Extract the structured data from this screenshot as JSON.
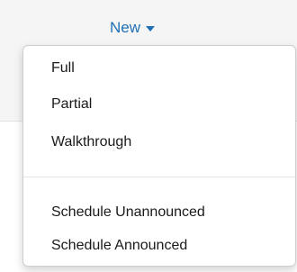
{
  "header": {
    "new_label": "New",
    "caret_icon": "caret-down-icon",
    "accent_color": "#1f6fb5"
  },
  "menu": {
    "items": [
      {
        "label": "Full"
      },
      {
        "label": "Partial"
      },
      {
        "label": "Walkthrough"
      }
    ],
    "schedule_items": [
      {
        "label": "Schedule Unannounced"
      },
      {
        "label": "Schedule Announced"
      }
    ]
  }
}
